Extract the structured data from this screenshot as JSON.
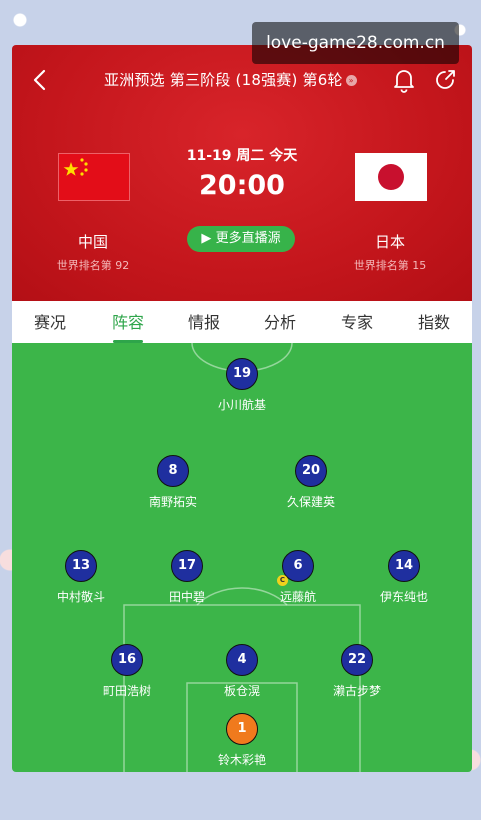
{
  "header": {
    "title": "亚洲预选 第三阶段 (18强赛) 第6轮",
    "title_arrow": "»",
    "date": "11-19 周二 今天",
    "time": "20:00",
    "live_button": "更多直播源",
    "home": {
      "name": "中国",
      "rank": "世界排名第 92",
      "flag": "china-flag"
    },
    "away": {
      "name": "日本",
      "rank": "世界排名第 15",
      "flag": "japan-flag"
    }
  },
  "tabs": [
    "赛况",
    "阵容",
    "情报",
    "分析",
    "专家",
    "指数"
  ],
  "active_tab": "阵容",
  "lineup": {
    "forward": [
      {
        "number": "19",
        "name": "小川航基"
      }
    ],
    "attacking_mid": [
      {
        "number": "8",
        "name": "南野拓实"
      },
      {
        "number": "20",
        "name": "久保建英"
      }
    ],
    "midfield": [
      {
        "number": "13",
        "name": "中村敬斗"
      },
      {
        "number": "17",
        "name": "田中碧"
      },
      {
        "number": "6",
        "name": "远藤航",
        "captain": "C"
      },
      {
        "number": "14",
        "name": "伊东纯也"
      }
    ],
    "defense": [
      {
        "number": "16",
        "name": "町田浩树"
      },
      {
        "number": "4",
        "name": "板仓滉"
      },
      {
        "number": "22",
        "name": "濑古步梦"
      }
    ],
    "goalkeeper": [
      {
        "number": "1",
        "name": "铃木彩艳"
      }
    ]
  },
  "watermark": "love-game28.com.cn",
  "colors": {
    "header_red": "#c4161c",
    "pitch_green": "#3cb549",
    "player_blue": "#1f2f9f",
    "gk_orange": "#f07a1d",
    "accent_green": "#2ea54a"
  }
}
